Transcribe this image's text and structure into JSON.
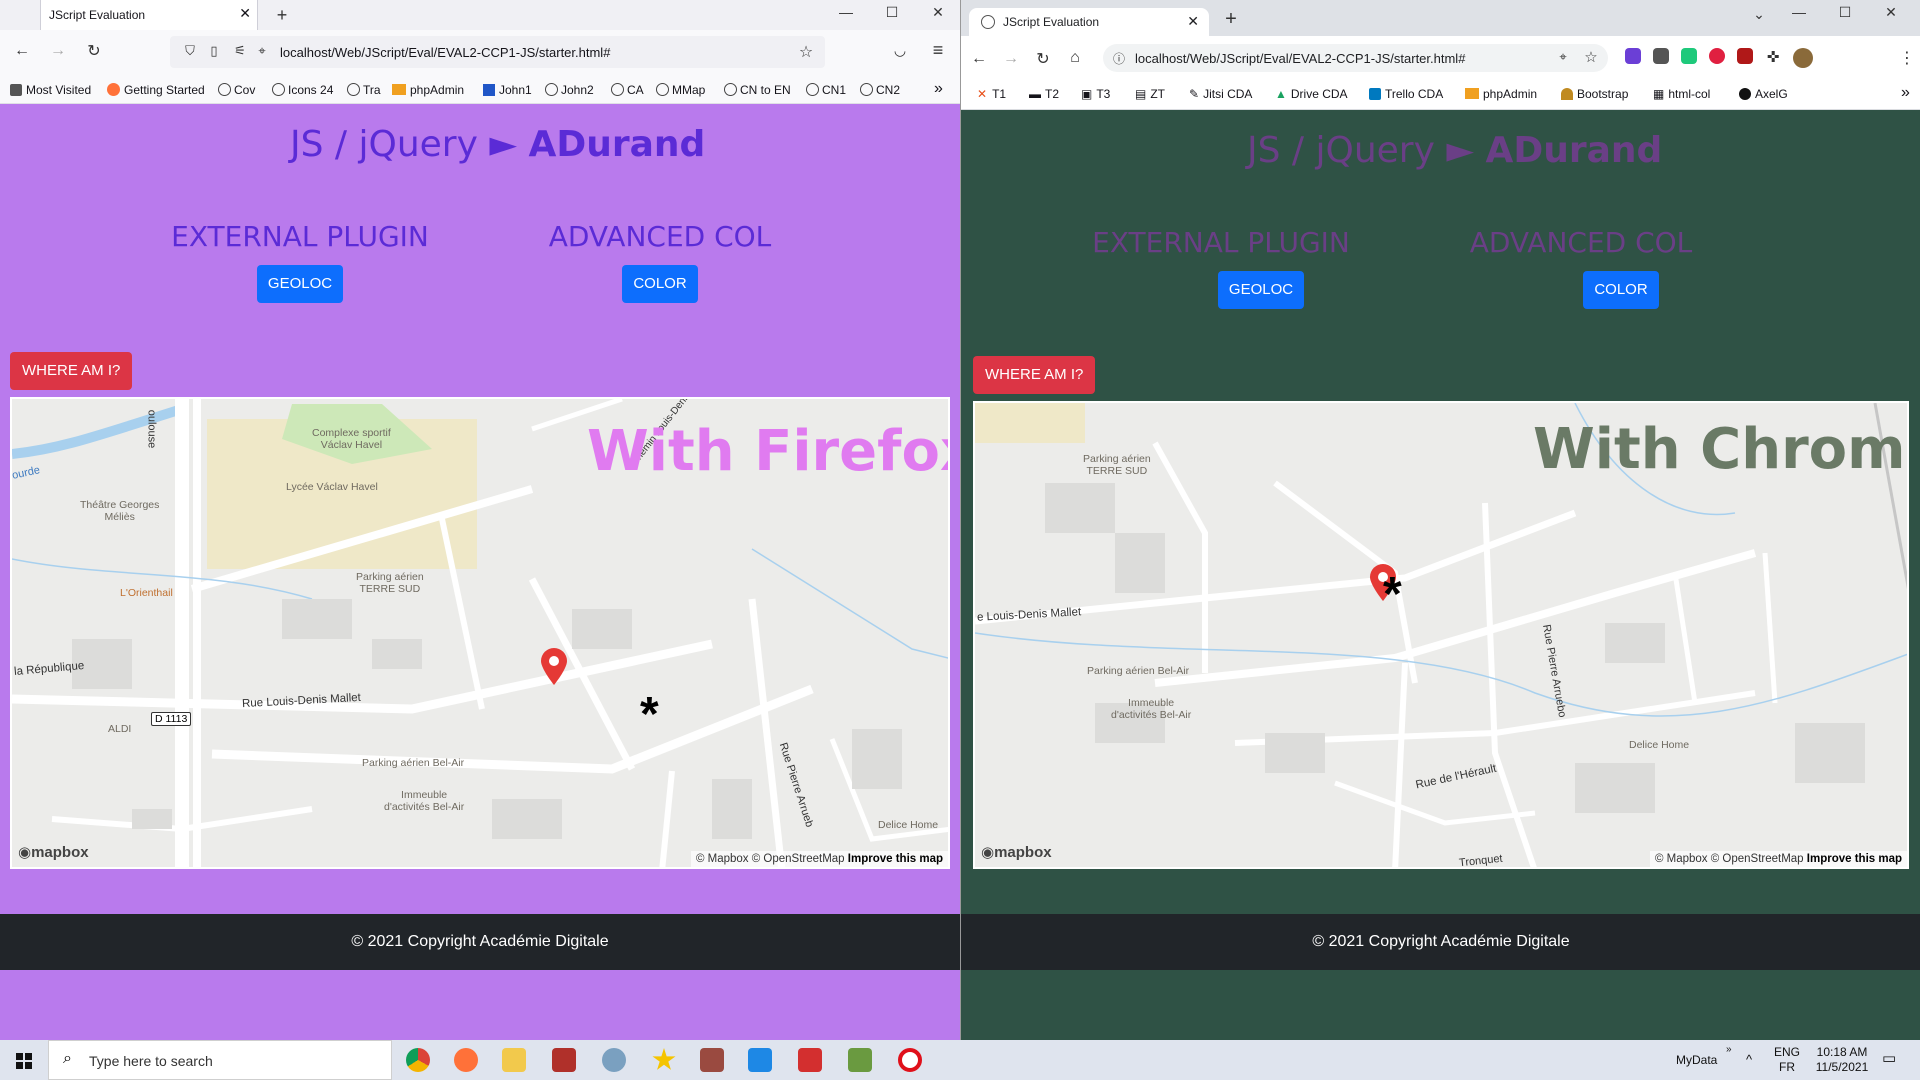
{
  "firefox": {
    "tab_title": "JScript Evaluation",
    "url": "localhost/Web/JScript/Eval/EVAL2-CCP1-JS/starter.html#",
    "bookmarks": [
      "Most Visited",
      "Getting Started",
      "Cov",
      "Icons 24",
      "Tra",
      "phpAdmin",
      "John1",
      "John2",
      "CA",
      "MMap",
      "CN to EN",
      "CN1",
      "CN2"
    ],
    "page": {
      "title_prefix": "JS / jQuery ► ",
      "title_name": "ADurand",
      "section1_heading": "EXTERNAL PLUGIN",
      "section1_button": "GEOLOC",
      "section2_heading": "ADVANCED COL",
      "section2_button": "COLOR",
      "where_button": "WHERE AM I?",
      "overlay_text": "With Firefox",
      "map_labels": {
        "sport": "Complexe sportif\nVáclav Havel",
        "lycee": "Lycée Václav Havel",
        "theatre": "Théâtre Georges\nMéliès",
        "parking1": "Parking aérien\nTERRE SUD",
        "orient": "L'Orienthail",
        "street_rld": "Rue Louis-Denis Mallet",
        "republique": "la République",
        "aldi": "ALDI",
        "d1113": "D 1113",
        "parking2": "Parking aérien Bel-Air",
        "immeuble": "Immeuble\nd'activités Bel-Air",
        "arrueb": "Rue Pierre Arrueb",
        "delice": "Delice Home",
        "chemin": "Chemin Louis-Denis M",
        "oulouse": "oulouse",
        "ourde": "ourde"
      },
      "attribution_left": "© Mapbox © OpenStreetMap ",
      "attribution_link": "Improve this map",
      "mapbox_logo": "mapbox",
      "footer": "© 2021 Copyright Académie Digitale"
    },
    "colors": {
      "page_bg": "#b97aed",
      "title": "#5b2bd6",
      "heading": "#5b2bd6",
      "overlay": "#e07bf0"
    }
  },
  "chrome": {
    "tab_title": "JScript Evaluation",
    "url": "localhost/Web/JScript/Eval/EVAL2-CCP1-JS/starter.html#",
    "bookmarks": [
      "T1",
      "T2",
      "T3",
      "ZT",
      "Jitsi CDA",
      "Drive CDA",
      "Trello CDA",
      "phpAdmin",
      "Bootstrap",
      "html-col",
      "AxelG"
    ],
    "page": {
      "title_prefix": "JS / jQuery ► ",
      "title_name": "ADurand",
      "section1_heading": "EXTERNAL PLUGIN",
      "section1_button": "GEOLOC",
      "section2_heading": "ADVANCED COL",
      "section2_button": "COLOR",
      "where_button": "WHERE AM I?",
      "overlay_text": "With Chrome",
      "map_labels": {
        "parking1": "Parking aérien\nTERRE SUD",
        "street_rld": "e Louis-Denis Mallet",
        "parking2": "Parking aérien Bel-Air",
        "immeuble": "Immeuble\nd'activités Bel-Air",
        "arrueb": "Rue Pierre Arruebo",
        "delice": "Delice Home",
        "herault": "Rue de l'Hérault",
        "tronquet": "Tronquet"
      },
      "attribution_left": "© Mapbox © OpenStreetMap ",
      "attribution_link": "Improve this map",
      "mapbox_logo": "mapbox",
      "footer": "© 2021 Copyright Académie Digitale"
    },
    "colors": {
      "page_bg": "#2f5245",
      "title": "#6a3f86",
      "heading": "#6a3f86",
      "overlay": "#6a7a66"
    }
  },
  "taskbar": {
    "search_placeholder": "Type here to search",
    "tray_label": "MyData",
    "lang_top": "ENG",
    "lang_bottom": "FR",
    "time": "10:18 AM",
    "date": "11/5/2021"
  }
}
